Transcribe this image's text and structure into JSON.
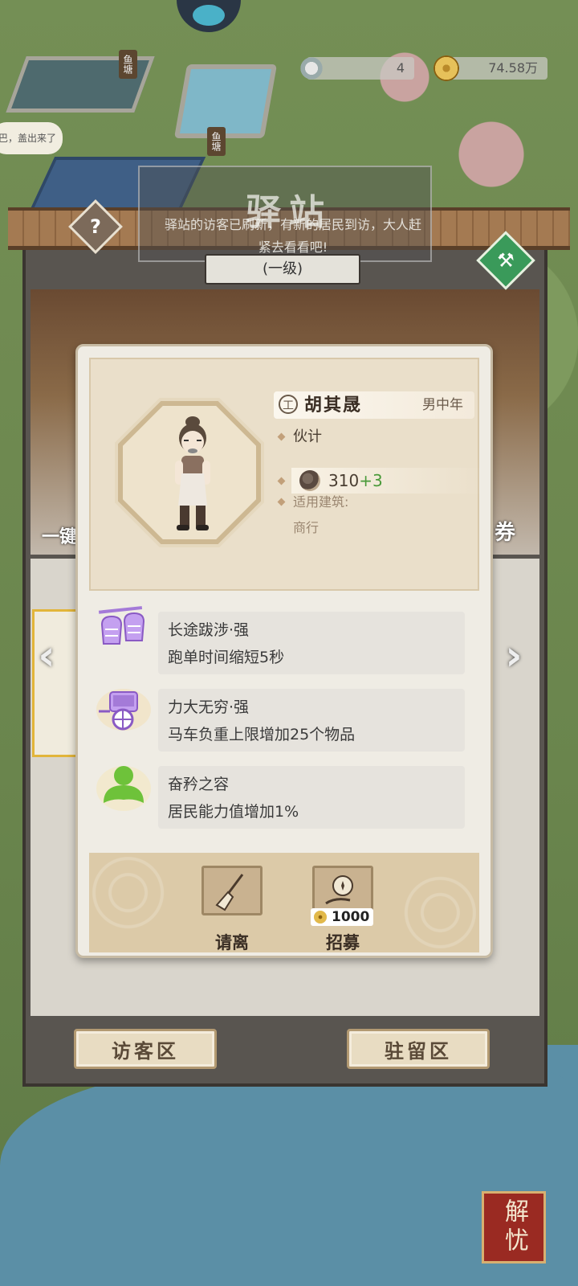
{
  "resources": {
    "silver": "4",
    "coins": "74.58万"
  },
  "map": {
    "speech_bubble": "巴，盖出来了",
    "sign_fishpond_1": "鱼塘",
    "sign_fishpond_2": "鱼塘"
  },
  "station": {
    "title": "驿站",
    "notice": "驿站的访客已刷新，有新的居民到访，大人赶紧去看看吧!",
    "level": "(一级)",
    "left_label": "一键",
    "right_label": "券",
    "tabs": {
      "visitor": "访客区",
      "resident": "驻留区"
    }
  },
  "resident": {
    "name": "胡其晟",
    "job_badge": "工",
    "gender_age": "男中年",
    "role": "伙计",
    "power": "310",
    "power_bonus": "+3",
    "building_label": "适用建筑:",
    "building": "商行"
  },
  "traits": [
    {
      "name": "长途跋涉·强",
      "desc": "跑单时间缩短5秒",
      "icon": "baskets-icon",
      "color": "#a47ad8"
    },
    {
      "name": "力大无穷·强",
      "desc": "马车负重上限增加25个物品",
      "icon": "cart-icon",
      "color": "#a47ad8"
    },
    {
      "name": "奋矜之容",
      "desc": "居民能力值增加1%",
      "icon": "person-icon",
      "color": "#6ec23a"
    }
  ],
  "actions": {
    "dismiss": "请离",
    "recruit": "招募",
    "recruit_cost": "1000"
  },
  "relief_button": "解忧"
}
